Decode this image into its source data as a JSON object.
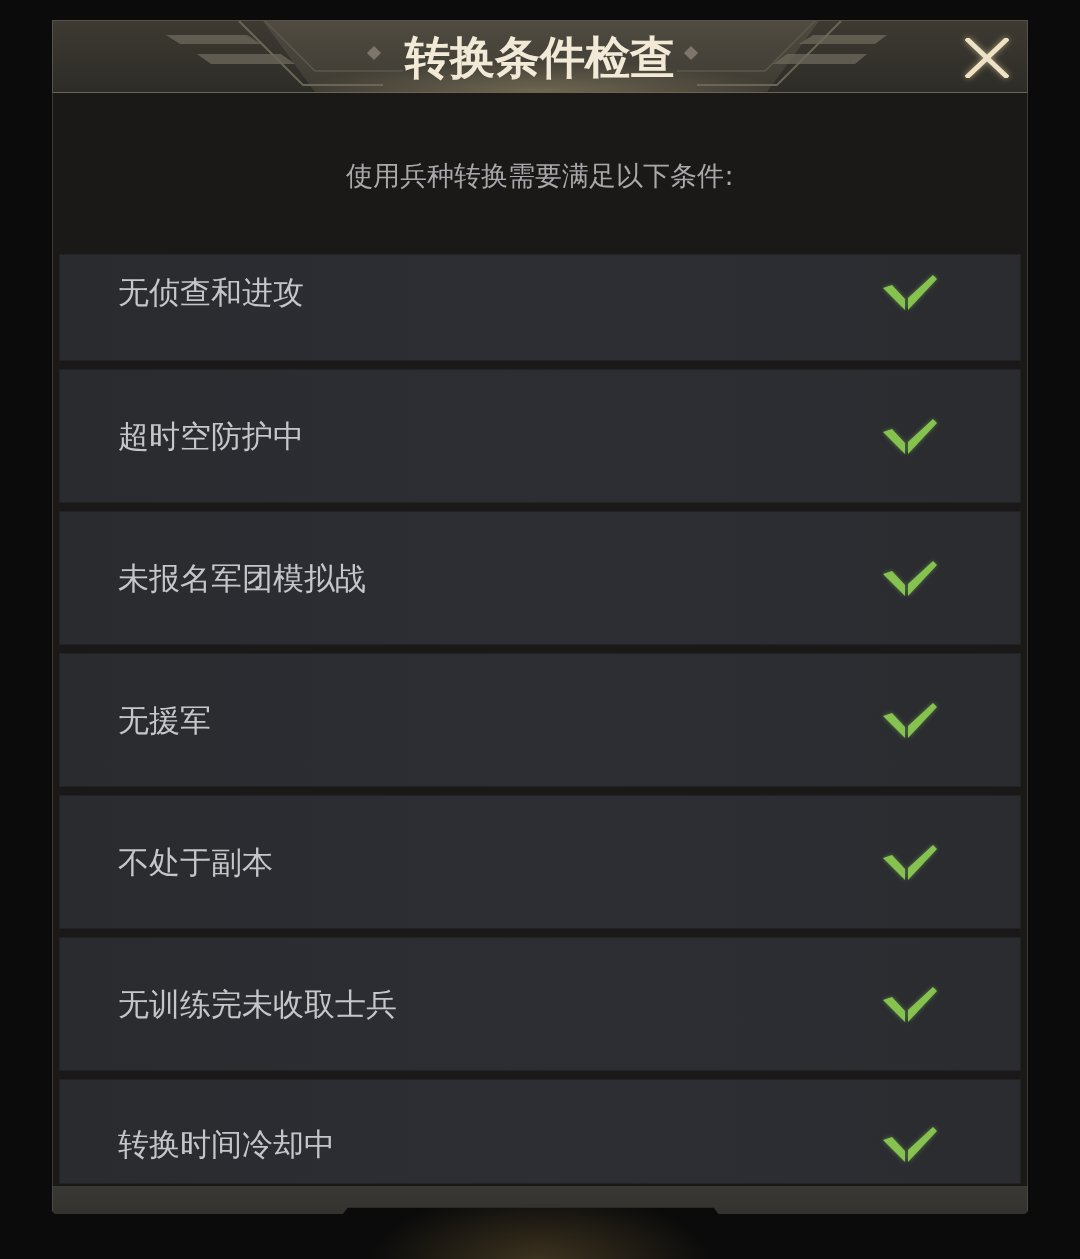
{
  "dialog": {
    "title": "转换条件检查",
    "subtitle": "使用兵种转换需要满足以下条件:"
  },
  "conditions": [
    {
      "label": "无侦查和进攻",
      "checked": true
    },
    {
      "label": "超时空防护中",
      "checked": true
    },
    {
      "label": "未报名军团模拟战",
      "checked": true
    },
    {
      "label": "无援军",
      "checked": true
    },
    {
      "label": "不处于副本",
      "checked": true
    },
    {
      "label": "无训练完未收取士兵",
      "checked": true
    },
    {
      "label": "转换时间冷却中",
      "checked": true
    }
  ]
}
